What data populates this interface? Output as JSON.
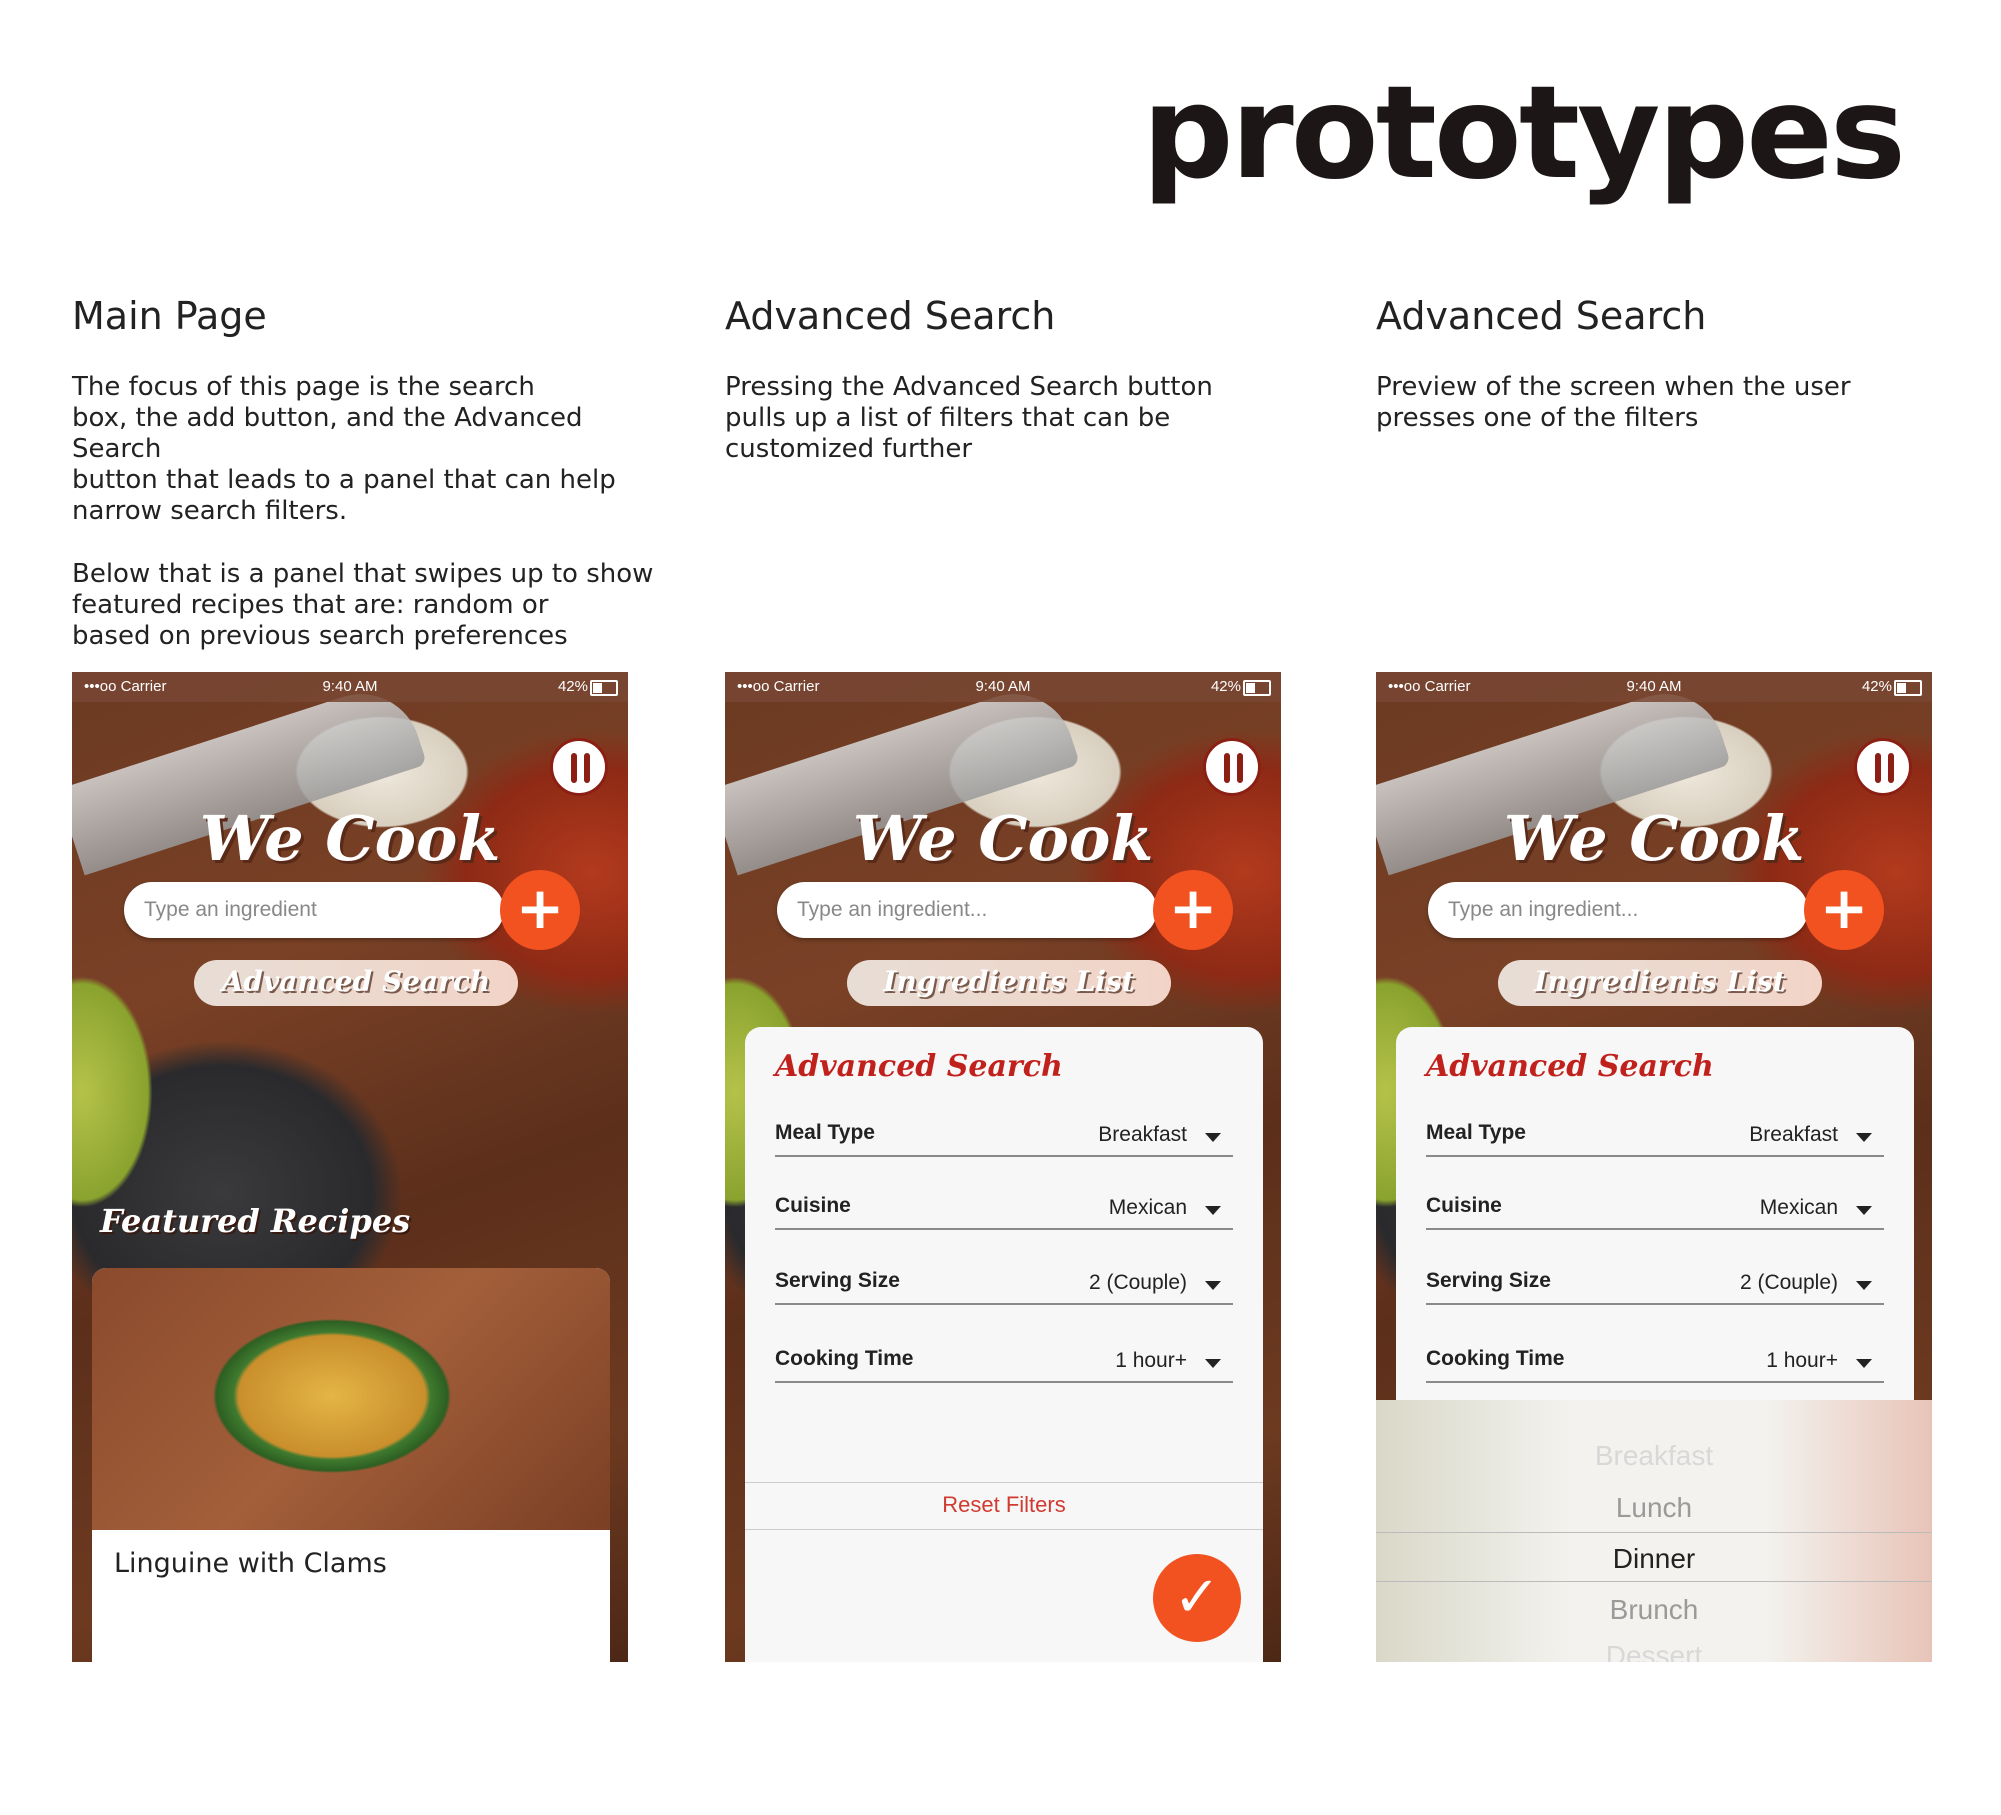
{
  "page": {
    "title": "prototypes"
  },
  "columns": [
    {
      "heading": "Main Page",
      "paragraphs": [
        "The focus of this page is the search\nbox, the add button, and the Advanced Search\nbutton that leads to a panel that can help\nnarrow search filters.",
        "Below that is a panel that swipes up to show\nfeatured recipes that are: random or\nbased on previous search preferences"
      ]
    },
    {
      "heading": "Advanced Search",
      "paragraphs": [
        "Pressing the Advanced Search button\npulls up a list of filters that can be\ncustomized further"
      ]
    },
    {
      "heading": "Advanced Search",
      "paragraphs": [
        "Preview of the screen when the user\npresses one of the filters"
      ]
    }
  ],
  "status_bar": {
    "carrier": "•••oo Carrier",
    "time": "9:40 AM",
    "battery": "42%"
  },
  "app": {
    "logo": "We Cook",
    "add_label": "+"
  },
  "phone1": {
    "search_placeholder": "Type an ingredient",
    "pill_label": "Advanced Search",
    "featured_title": "Featured Recipes",
    "recipe_name": "Linguine with Clams"
  },
  "phone2": {
    "search_placeholder": "Type an ingredient...",
    "pill_label": "Ingredients List",
    "panel_title": "Advanced Search",
    "filters": [
      {
        "label": "Meal Type",
        "value": "Breakfast"
      },
      {
        "label": "Cuisine",
        "value": "Mexican"
      },
      {
        "label": "Serving Size",
        "value": "2 (Couple)"
      },
      {
        "label": "Cooking Time",
        "value": "1 hour+"
      }
    ],
    "reset_label": "Reset Filters",
    "confirm_label": "✓"
  },
  "phone3": {
    "search_placeholder": "Type an ingredient...",
    "pill_label": "Ingredients List",
    "panel_title": "Advanced Search",
    "filters": [
      {
        "label": "Meal Type",
        "value": "Breakfast"
      },
      {
        "label": "Cuisine",
        "value": "Mexican"
      },
      {
        "label": "Serving Size",
        "value": "2 (Couple)"
      },
      {
        "label": "Cooking Time",
        "value": "1 hour+"
      }
    ],
    "picker_options": [
      "Breakfast",
      "Lunch",
      "Dinner",
      "Brunch",
      "Dessert"
    ],
    "picker_selected": "Dinner"
  },
  "colors": {
    "accent": "#f1521f",
    "brand_red": "#c1211c",
    "text": "#1a1a1a"
  }
}
